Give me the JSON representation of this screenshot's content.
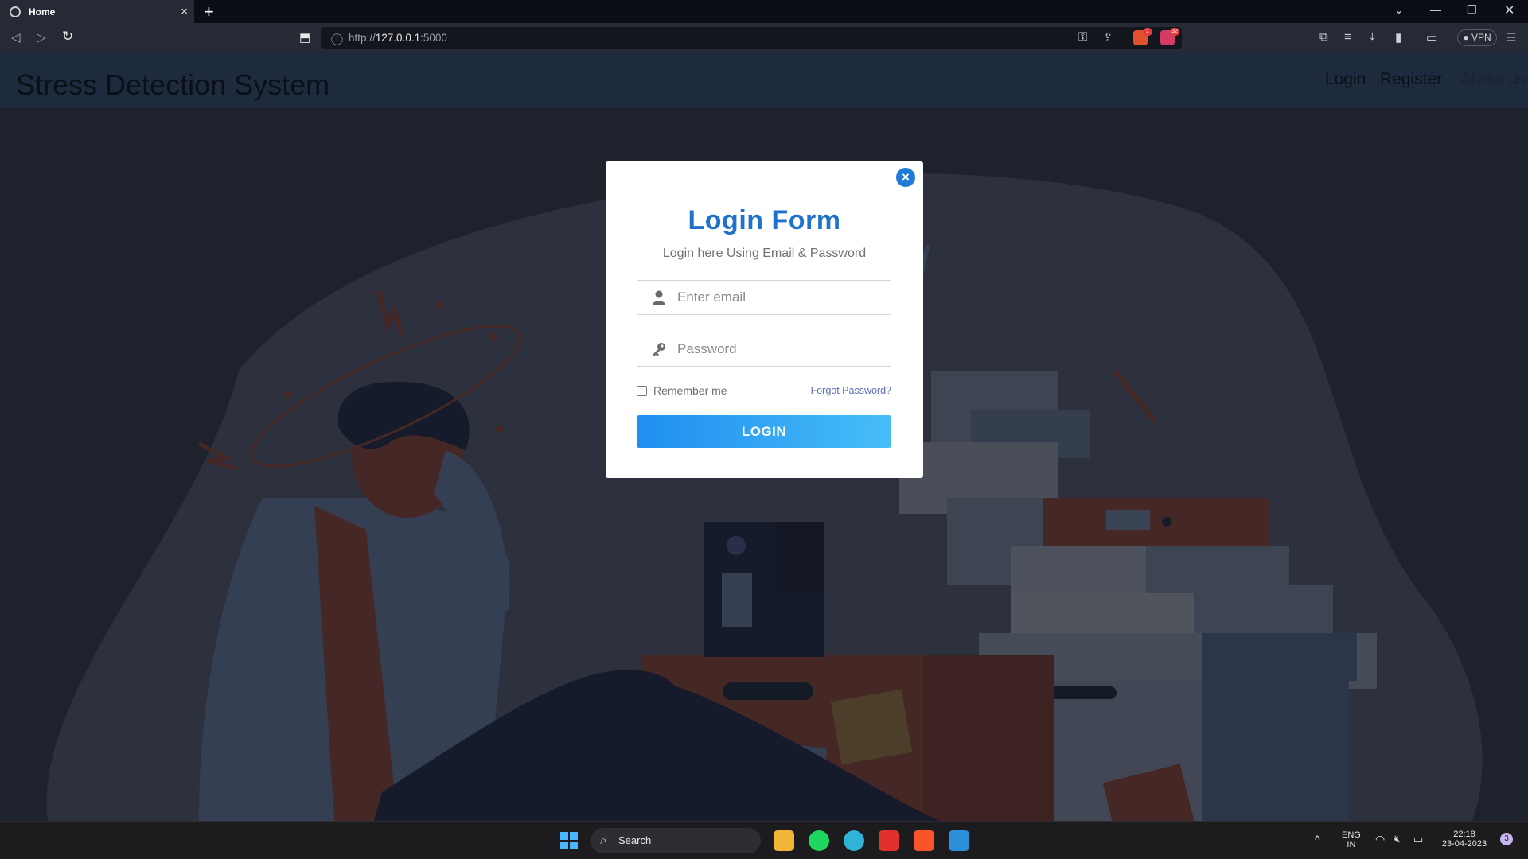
{
  "browser": {
    "tab_title": "Home",
    "tab_close": "×",
    "new_tab": "+",
    "url_prefix": "http://",
    "url_host": "127.0.0.1",
    "url_port": ":5000",
    "vpn_label": "● VPN",
    "shield_badge": "1",
    "rewards_badge": "32"
  },
  "navbar": {
    "brand": "Stress Detection System",
    "links": [
      "Login",
      "Register",
      "About us"
    ]
  },
  "login_modal": {
    "close": "×",
    "title": "Login Form",
    "subtitle": "Login here Using Email & Password",
    "email_placeholder": "Enter email",
    "password_placeholder": "Password",
    "remember_label": "Remember me",
    "forgot_label": "Forgot Password?",
    "submit_label": "LOGIN"
  },
  "taskbar": {
    "search_label": "Search",
    "lang_line1": "ENG",
    "lang_line2": "IN",
    "time": "22:18",
    "date": "23-04-2023",
    "notification_count": "3"
  },
  "colors": {
    "navbar": "#1e2b3e",
    "title_blue": "#1f72c9",
    "button_start": "#1f8ef0",
    "button_end": "#47bdf7"
  }
}
